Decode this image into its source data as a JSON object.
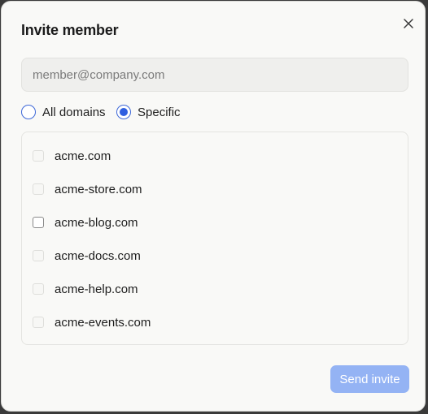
{
  "dialog": {
    "title": "Invite member",
    "close_icon": "close-icon"
  },
  "email": {
    "placeholder": "member@company.com",
    "value": ""
  },
  "scope": {
    "options": [
      {
        "label": "All domains",
        "selected": false
      },
      {
        "label": "Specific",
        "selected": true
      }
    ],
    "accent_color": "#2f5fe0"
  },
  "domains": [
    {
      "label": "acme.com",
      "checked": false
    },
    {
      "label": "acme-store.com",
      "checked": false
    },
    {
      "label": "acme-blog.com",
      "checked": false
    },
    {
      "label": "acme-docs.com",
      "checked": false
    },
    {
      "label": "acme-help.com",
      "checked": false
    },
    {
      "label": "acme-events.com",
      "checked": false
    }
  ],
  "footer": {
    "send_label": "Send invite",
    "send_disabled": true,
    "send_color": "#94b3f4"
  }
}
